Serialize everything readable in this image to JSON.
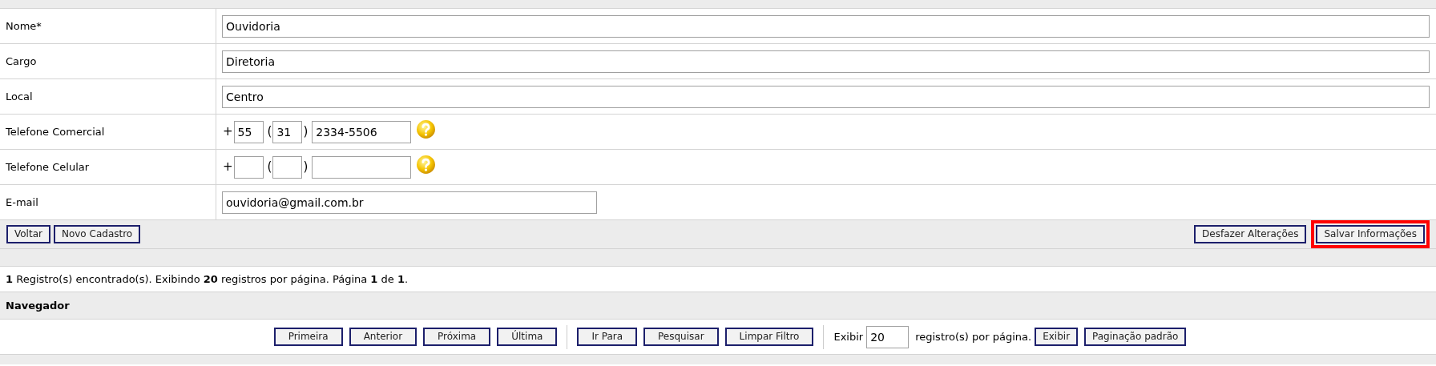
{
  "fields": [
    {
      "kind": "text",
      "label": "Nome*",
      "value": "Ouvidoria",
      "wide": true
    },
    {
      "kind": "text",
      "label": "Cargo",
      "value": "Diretoria",
      "wide": true
    },
    {
      "kind": "text",
      "label": "Local",
      "value": "Centro",
      "wide": true
    },
    {
      "kind": "phone",
      "label": "Telefone Comercial",
      "prefix": "+",
      "country": "55",
      "open": "(",
      "area": "31",
      "close": ")",
      "number": "2334-5506"
    },
    {
      "kind": "phone",
      "label": "Telefone Celular",
      "prefix": "+",
      "open": "(",
      "close": ")"
    },
    {
      "kind": "text",
      "label": "E-mail",
      "value": "ouvidoria@gmail.com.br",
      "wide": false
    }
  ],
  "left_buttons": [
    "Voltar",
    "Novo Cadastro"
  ],
  "right_buttons": [
    {
      "label": "Desfazer Alterações",
      "highlighted": false
    },
    {
      "label": "Salvar Informações",
      "highlighted": true
    }
  ],
  "summary": "**1** Registro(s) encontrado(s). Exibindo **20** registros por página. Página **1** de **1**.",
  "navigator": {
    "title": "Navegador",
    "groups": [
      [
        "Primeira",
        "Anterior",
        "Próxima",
        "Última"
      ],
      [
        "Ir Para",
        "Pesquisar",
        "Limpar Filtro"
      ]
    ],
    "show_label": "Exibir",
    "per_page": "20",
    "per_page_suffix": "registro(s) por página.",
    "buttons": [
      "Exibir",
      "Paginação padrão"
    ]
  }
}
